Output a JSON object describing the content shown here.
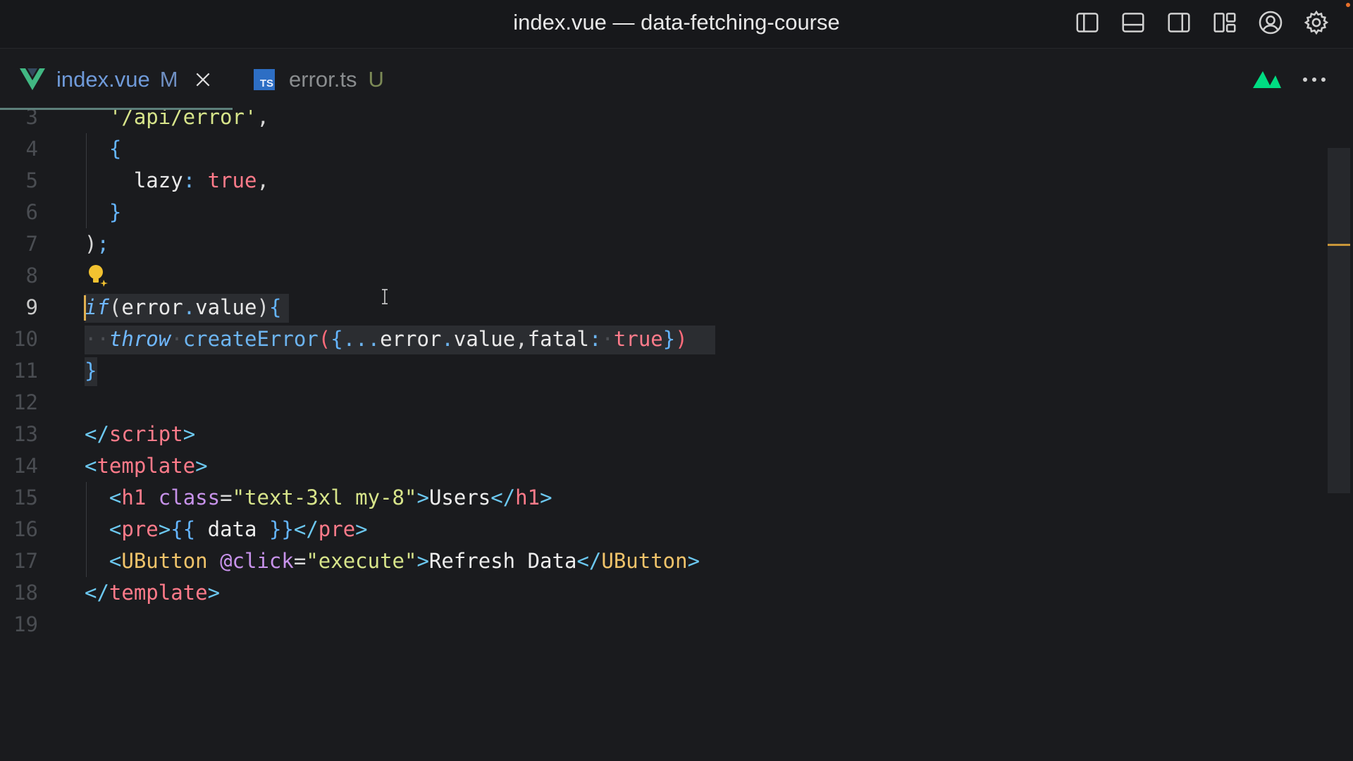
{
  "window": {
    "title": "index.vue — data-fetching-course",
    "toolbar_icons": [
      "toggle-primary-sidebar-icon",
      "toggle-panel-icon",
      "toggle-secondary-sidebar-icon",
      "customize-layout-icon",
      "accounts-icon",
      "settings-gear-icon"
    ],
    "notification_color": "#e8702a"
  },
  "tabs": [
    {
      "name": "index.vue",
      "status": "M",
      "icon": "vue-logo-icon",
      "active": true
    },
    {
      "name": "error.ts",
      "status": "U",
      "icon": "typescript-logo-icon",
      "active": false
    }
  ],
  "tab_actions": [
    "nuxt-logo-icon",
    "more-actions-icon"
  ],
  "editor": {
    "current_line": "9",
    "lines": [
      {
        "n": "3",
        "segs": [
          [
            "  ",
            "ws"
          ],
          [
            "'/api/error'",
            "t-str"
          ],
          [
            ",",
            "t-punc"
          ]
        ]
      },
      {
        "n": "4",
        "segs": [
          [
            "  ",
            "ws"
          ],
          [
            "{",
            "t-brace"
          ]
        ]
      },
      {
        "n": "5",
        "segs": [
          [
            "    ",
            "ws"
          ],
          [
            "lazy",
            "t-key"
          ],
          [
            ":",
            "t-fn"
          ],
          [
            " ",
            "ws"
          ],
          [
            "true",
            "t-bool"
          ],
          [
            ",",
            "t-punc"
          ]
        ]
      },
      {
        "n": "6",
        "segs": [
          [
            "  ",
            "ws"
          ],
          [
            "}",
            "t-brace"
          ]
        ]
      },
      {
        "n": "7",
        "segs": [
          [
            ")",
            "t-punc"
          ],
          [
            ";",
            "t-fn"
          ]
        ]
      },
      {
        "n": "8",
        "segs": []
      },
      {
        "n": "9",
        "segs": [
          [
            "if",
            "t-kw"
          ],
          [
            "(",
            "t-punc"
          ],
          [
            "error",
            "t-key"
          ],
          [
            ".",
            "t-fn"
          ],
          [
            "value",
            "t-key"
          ],
          [
            ")",
            "t-punc"
          ],
          [
            "{",
            "t-brace"
          ]
        ]
      },
      {
        "n": "10",
        "segs": [
          [
            "··",
            "ws"
          ],
          [
            "throw",
            "t-kw"
          ],
          [
            "·",
            "ws"
          ],
          [
            "createError",
            "t-fn"
          ],
          [
            "(",
            "t-paren"
          ],
          [
            "{",
            "t-brace"
          ],
          [
            "...",
            "t-fn"
          ],
          [
            "error",
            "t-key"
          ],
          [
            ".",
            "t-fn"
          ],
          [
            "value",
            "t-key"
          ],
          [
            ",",
            "t-punc"
          ],
          [
            "fatal",
            "t-key"
          ],
          [
            ":",
            "t-fn"
          ],
          [
            "·",
            "ws"
          ],
          [
            "true",
            "t-bool"
          ],
          [
            "}",
            "t-brace"
          ],
          [
            ")",
            "t-paren"
          ]
        ]
      },
      {
        "n": "11",
        "segs": [
          [
            "}",
            "t-brace"
          ]
        ]
      },
      {
        "n": "12",
        "segs": []
      },
      {
        "n": "13",
        "segs": [
          [
            "</",
            "t-angle"
          ],
          [
            "script",
            "t-tag"
          ],
          [
            ">",
            "t-angle"
          ]
        ]
      },
      {
        "n": "14",
        "segs": [
          [
            "<",
            "t-angle"
          ],
          [
            "template",
            "t-tag"
          ],
          [
            ">",
            "t-angle"
          ]
        ]
      },
      {
        "n": "15",
        "segs": [
          [
            "  ",
            "ws"
          ],
          [
            "<",
            "t-angle"
          ],
          [
            "h1",
            "t-tag"
          ],
          [
            " ",
            "ws"
          ],
          [
            "class",
            "t-attr"
          ],
          [
            "=",
            "t-punc"
          ],
          [
            "\"text-3xl my-8\"",
            "t-attrv"
          ],
          [
            ">",
            "t-angle"
          ],
          [
            "Users",
            "t-text"
          ],
          [
            "</",
            "t-angle"
          ],
          [
            "h1",
            "t-tag"
          ],
          [
            ">",
            "t-angle"
          ]
        ]
      },
      {
        "n": "16",
        "segs": [
          [
            "  ",
            "ws"
          ],
          [
            "<",
            "t-angle"
          ],
          [
            "pre",
            "t-tag"
          ],
          [
            ">",
            "t-angle"
          ],
          [
            "{{",
            "t-brace"
          ],
          [
            " data ",
            "t-text"
          ],
          [
            "}}",
            "t-brace"
          ],
          [
            "</",
            "t-angle"
          ],
          [
            "pre",
            "t-tag"
          ],
          [
            ">",
            "t-angle"
          ]
        ]
      },
      {
        "n": "17",
        "segs": [
          [
            "  ",
            "ws"
          ],
          [
            "<",
            "t-angle"
          ],
          [
            "UButton",
            "t-comp"
          ],
          [
            " ",
            "ws"
          ],
          [
            "@click",
            "t-attr"
          ],
          [
            "=",
            "t-punc"
          ],
          [
            "\"execute\"",
            "t-attrv"
          ],
          [
            ">",
            "t-angle"
          ],
          [
            "Refresh Data",
            "t-text"
          ],
          [
            "</",
            "t-angle"
          ],
          [
            "UButton",
            "t-comp"
          ],
          [
            ">",
            "t-angle"
          ]
        ]
      },
      {
        "n": "18",
        "segs": [
          [
            "</",
            "t-angle"
          ],
          [
            "template",
            "t-tag"
          ],
          [
            ">",
            "t-angle"
          ]
        ]
      },
      {
        "n": "19",
        "segs": []
      }
    ]
  }
}
